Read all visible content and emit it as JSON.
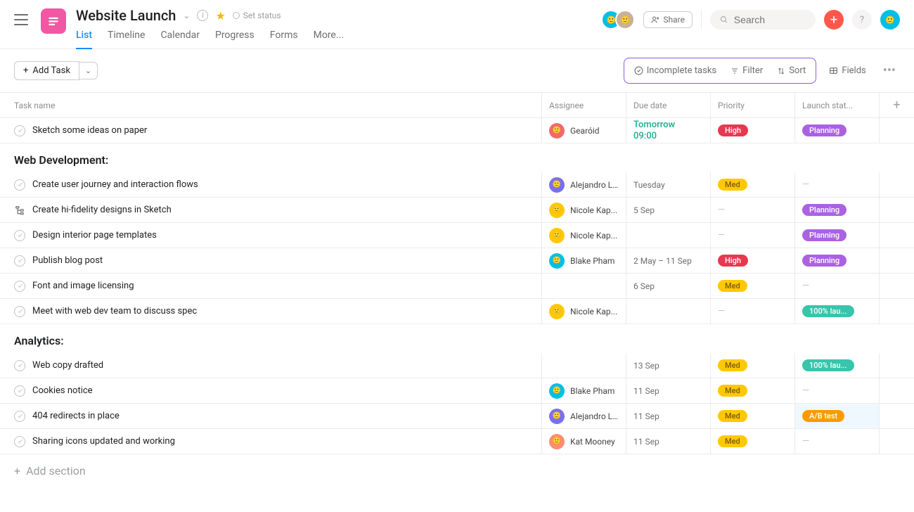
{
  "header": {
    "project_title": "Website Launch",
    "set_status": "Set status",
    "tabs": [
      "List",
      "Timeline",
      "Calendar",
      "Progress",
      "Forms",
      "More..."
    ],
    "active_tab": 0,
    "share_label": "Share",
    "search_placeholder": "Search"
  },
  "toolbar": {
    "add_task": "Add Task",
    "incomplete": "Incomplete tasks",
    "filter": "Filter",
    "sort": "Sort",
    "fields": "Fields"
  },
  "columns": {
    "name": "Task name",
    "assignee": "Assignee",
    "due": "Due date",
    "priority": "Priority",
    "launch": "Launch stat..."
  },
  "top_task": {
    "name": "Sketch some ideas on paper",
    "assignee": "Gearóid",
    "assignee_color": "#f06a6a",
    "due_line1": "Tomorrow",
    "due_line2": "09:00",
    "priority": "High",
    "launch": "Planning"
  },
  "sections": [
    {
      "title": "Web Development:",
      "tasks": [
        {
          "name": "Create user journey and interaction flows",
          "assignee": "Alejandro L...",
          "assignee_color": "#7a6ff0",
          "due": "Tuesday",
          "priority": "Med",
          "launch": "",
          "icon": "check"
        },
        {
          "name": "Create hi-fidelity designs in Sketch",
          "assignee": "Nicole Kap...",
          "assignee_color": "#ffc800",
          "due": "5 Sep",
          "priority": "",
          "launch": "Planning",
          "icon": "subtask"
        },
        {
          "name": "Design interior page templates",
          "assignee": "Nicole Kap...",
          "assignee_color": "#ffc800",
          "due": "",
          "priority": "",
          "launch": "Planning",
          "icon": "check"
        },
        {
          "name": "Publish blog post",
          "assignee": "Blake Pham",
          "assignee_color": "#00bfe6",
          "due": "2 May – 11 Sep",
          "priority": "High",
          "launch": "Planning",
          "icon": "check"
        },
        {
          "name": "Font and image licensing",
          "assignee": "",
          "assignee_color": "",
          "due": "6 Sep",
          "priority": "Med",
          "launch": "",
          "icon": "check"
        },
        {
          "name": "Meet with web dev team to discuss spec",
          "assignee": "Nicole Kap...",
          "assignee_color": "#ffc800",
          "due": "",
          "priority": "",
          "launch": "100% lau...",
          "launch_type": "complete",
          "icon": "check"
        }
      ]
    },
    {
      "title": "Analytics:",
      "tasks": [
        {
          "name": "Web copy drafted",
          "assignee": "",
          "assignee_color": "",
          "due": "13 Sep",
          "priority": "Med",
          "launch": "100% lau...",
          "launch_type": "complete",
          "icon": "check"
        },
        {
          "name": "Cookies notice",
          "assignee": "Blake Pham",
          "assignee_color": "#00bfe6",
          "due": "11 Sep",
          "priority": "Med",
          "launch": "",
          "icon": "check"
        },
        {
          "name": "404 redirects in place",
          "assignee": "Alejandro L...",
          "assignee_color": "#7a6ff0",
          "due": "11 Sep",
          "priority": "Med",
          "launch": "A/B test",
          "launch_type": "abtest",
          "icon": "check",
          "selected": true
        },
        {
          "name": "Sharing icons updated and working",
          "assignee": "Kat Mooney",
          "assignee_color": "#ff8d71",
          "due": "11 Sep",
          "priority": "Med",
          "launch": "",
          "icon": "check"
        }
      ]
    }
  ],
  "add_section": "Add section",
  "avatars": {
    "stack1_color": "#00bfe6",
    "stack2_color": "#c7b299",
    "user_color": "#00bfe6"
  }
}
